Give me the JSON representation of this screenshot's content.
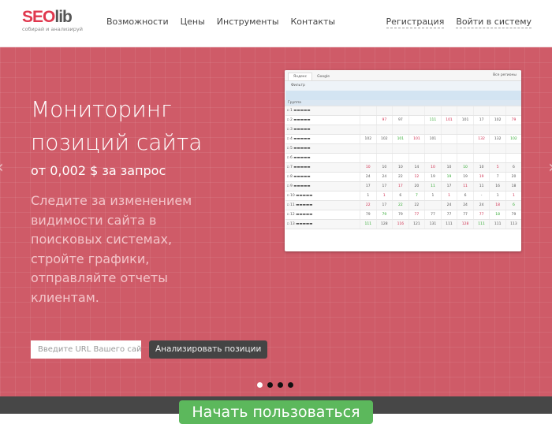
{
  "header": {
    "logo_text_a": "SEO",
    "logo_text_b": "lib",
    "logo_tagline": "собирай и анализируй",
    "nav": [
      "Возможности",
      "Цены",
      "Инструменты",
      "Контакты"
    ],
    "register": "Регистрация",
    "login": "Войти в систему"
  },
  "hero": {
    "title_line1": "Мониторинг",
    "title_line2": "позиций сайта",
    "price": "от 0,002 $ за запрос",
    "description": "Следите за изменением видимости сайта в поисковых системах, стройте графики, отправляйте отчеты клиентам.",
    "url_placeholder": "Введите URL Вашего сайта",
    "analyze_button": "Анализировать позиции",
    "slides": 4,
    "active_slide": 1
  },
  "screenshot": {
    "tabs": [
      "Яндекс",
      "Google"
    ],
    "region": "Все регионы",
    "toolbar": "Фильтр",
    "group": "Группа",
    "rows": [
      [
        "1",
        "",
        ""
      ],
      [
        "2",
        "",
        "",
        "97",
        "97",
        "",
        "111",
        "101",
        "101",
        "17",
        "102",
        "79"
      ],
      [
        "3",
        "",
        ""
      ],
      [
        "4",
        "",
        "102",
        "102",
        "101",
        "101",
        "101",
        "",
        "",
        "132",
        "132",
        "102"
      ],
      [
        "5",
        "",
        ""
      ],
      [
        "6",
        "",
        ""
      ],
      [
        "7",
        "",
        "10",
        "10",
        "10",
        "14",
        "10",
        "10",
        "10",
        "10",
        "5",
        "6"
      ],
      [
        "8",
        "",
        "24",
        "24",
        "22",
        "12",
        "19",
        "19",
        "19",
        "19",
        "7",
        "20"
      ],
      [
        "9",
        "",
        "17",
        "17",
        "17",
        "20",
        "11",
        "17",
        "11",
        "11",
        "16",
        "18"
      ],
      [
        "10",
        "",
        "1",
        "1",
        "6",
        "7",
        "1",
        "1",
        "6",
        "-",
        "1",
        "1"
      ],
      [
        "11",
        "",
        "22",
        "17",
        "22",
        "22",
        "",
        "24",
        "24",
        "24",
        "18",
        "6"
      ],
      [
        "12",
        "",
        "79",
        "79",
        "79",
        "77",
        "77",
        "77",
        "77",
        "77",
        "18",
        "79"
      ],
      [
        "13",
        "",
        "111",
        "128",
        "116",
        "121",
        "131",
        "111",
        "128",
        "111",
        "111",
        "113"
      ]
    ]
  },
  "footer": {
    "start_button": "Начать пользоваться"
  }
}
